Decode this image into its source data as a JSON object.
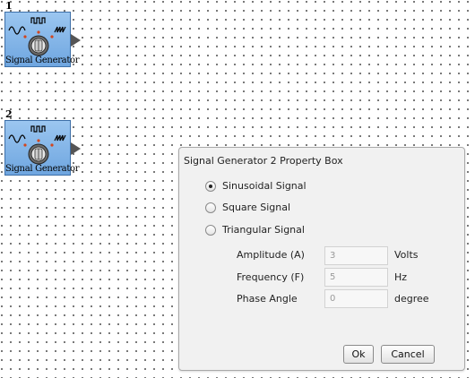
{
  "blocks": [
    {
      "number": "1",
      "label": "Signal Generator"
    },
    {
      "number": "2",
      "label": "Signal Generator"
    }
  ],
  "dialog": {
    "title": "Signal Generator 2 Property Box",
    "signal_types": [
      {
        "label": "Sinusoidal Signal",
        "checked": true
      },
      {
        "label": "Square Signal",
        "checked": false
      },
      {
        "label": "Triangular Signal",
        "checked": false
      }
    ],
    "fields": [
      {
        "label": "Amplitude (A)",
        "value": "3",
        "unit": "Volts"
      },
      {
        "label": "Frequency (F)",
        "value": "5",
        "unit": "Hz"
      },
      {
        "label": "Phase Angle",
        "value": "0",
        "unit": "degree"
      }
    ],
    "ok_label": "Ok",
    "cancel_label": "Cancel"
  },
  "colors": {
    "block_fill": "#7fb2e8",
    "block_border": "#3d6fa8",
    "dialog_bg": "#f1f1f1"
  }
}
